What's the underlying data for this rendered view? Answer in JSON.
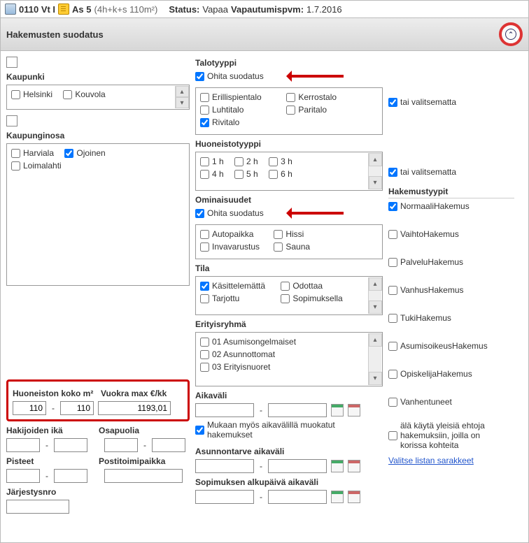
{
  "top": {
    "code": "0110 Vt I",
    "as": "As 5",
    "as_meta": "(4h+k+s  110m²)",
    "status_lbl": "Status:",
    "status_val": "Vapaa",
    "release_lbl": "Vapautumispvm:",
    "release_val": "1.7.2016"
  },
  "section_title": "Hakemusten suodatus",
  "col1": {
    "kaupunki_lbl": "Kaupunki",
    "kaupunki": [
      "Helsinki",
      "Kouvola"
    ],
    "kaupunginosa_lbl": "Kaupunginosa",
    "kaupunginosa": [
      {
        "lbl": "Harviala",
        "ck": false
      },
      {
        "lbl": "Ojoinen",
        "ck": true
      },
      {
        "lbl": "Loimalahti",
        "ck": false
      }
    ],
    "size_lbl": "Huoneiston koko m²",
    "size_from": "110",
    "size_to": "110",
    "rent_lbl": "Vuokra max €/kk",
    "rent_val": "1193,01",
    "age_lbl": "Hakijoiden ikä",
    "party_lbl": "Osapuolia",
    "points_lbl": "Pisteet",
    "post_lbl": "Postitoimipaikka",
    "order_lbl": "Järjestysnro"
  },
  "col2": {
    "talotyyppi_lbl": "Talotyyppi",
    "ohita": "Ohita suodatus",
    "talotyyppi": [
      {
        "lbl": "Erillispientalo",
        "ck": false
      },
      {
        "lbl": "Kerrostalo",
        "ck": false
      },
      {
        "lbl": "Luhtitalo",
        "ck": false
      },
      {
        "lbl": "Paritalo",
        "ck": false
      },
      {
        "lbl": "Rivitalo",
        "ck": true
      }
    ],
    "huone_lbl": "Huoneistotyyppi",
    "huone": [
      "1 h",
      "2 h",
      "3 h",
      "4 h",
      "5 h",
      "6 h"
    ],
    "omin_lbl": "Ominaisuudet",
    "omin": [
      "Autopaikka",
      "Hissi",
      "Invavarustus",
      "Sauna"
    ],
    "tila_lbl": "Tila",
    "tila": [
      {
        "lbl": "Käsittelemättä",
        "ck": true
      },
      {
        "lbl": "Odottaa",
        "ck": false
      },
      {
        "lbl": "Tarjottu",
        "ck": false
      },
      {
        "lbl": "Sopimuksella",
        "ck": false
      }
    ],
    "erityis_lbl": "Erityisryhmä",
    "erityis": [
      "01 Asumisongelmaiset",
      "02 Asunnottomat",
      "03 Erityisnuoret"
    ],
    "aikavali_lbl": "Aikaväli",
    "mukaan": "Mukaan myös aikavälillä muokatut hakemukset",
    "asunnontarve_lbl": "Asunnontarve aikaväli",
    "sopimus_lbl": "Sopimuksen alkupäivä aikaväli"
  },
  "col3": {
    "tai1": "tai valitsematta",
    "tai2": "tai valitsematta",
    "hake_lbl": "Hakemustyypit",
    "hake": [
      {
        "lbl": "NormaaliHakemus",
        "ck": true
      },
      {
        "lbl": "VaihtoHakemus",
        "ck": false
      },
      {
        "lbl": "PalveluHakemus",
        "ck": false
      },
      {
        "lbl": "VanhusHakemus",
        "ck": false
      },
      {
        "lbl": "TukiHakemus",
        "ck": false
      },
      {
        "lbl": "AsumisoikeusHakemus",
        "ck": false
      },
      {
        "lbl": "OpiskelijaHakemus",
        "ck": false
      },
      {
        "lbl": "Vanhentuneet",
        "ck": false
      }
    ],
    "ala": "älä käytä yleisiä ehtoja hakemuksiin, joilla on korissa kohteita",
    "link": "Valitse listan sarakkeet"
  }
}
